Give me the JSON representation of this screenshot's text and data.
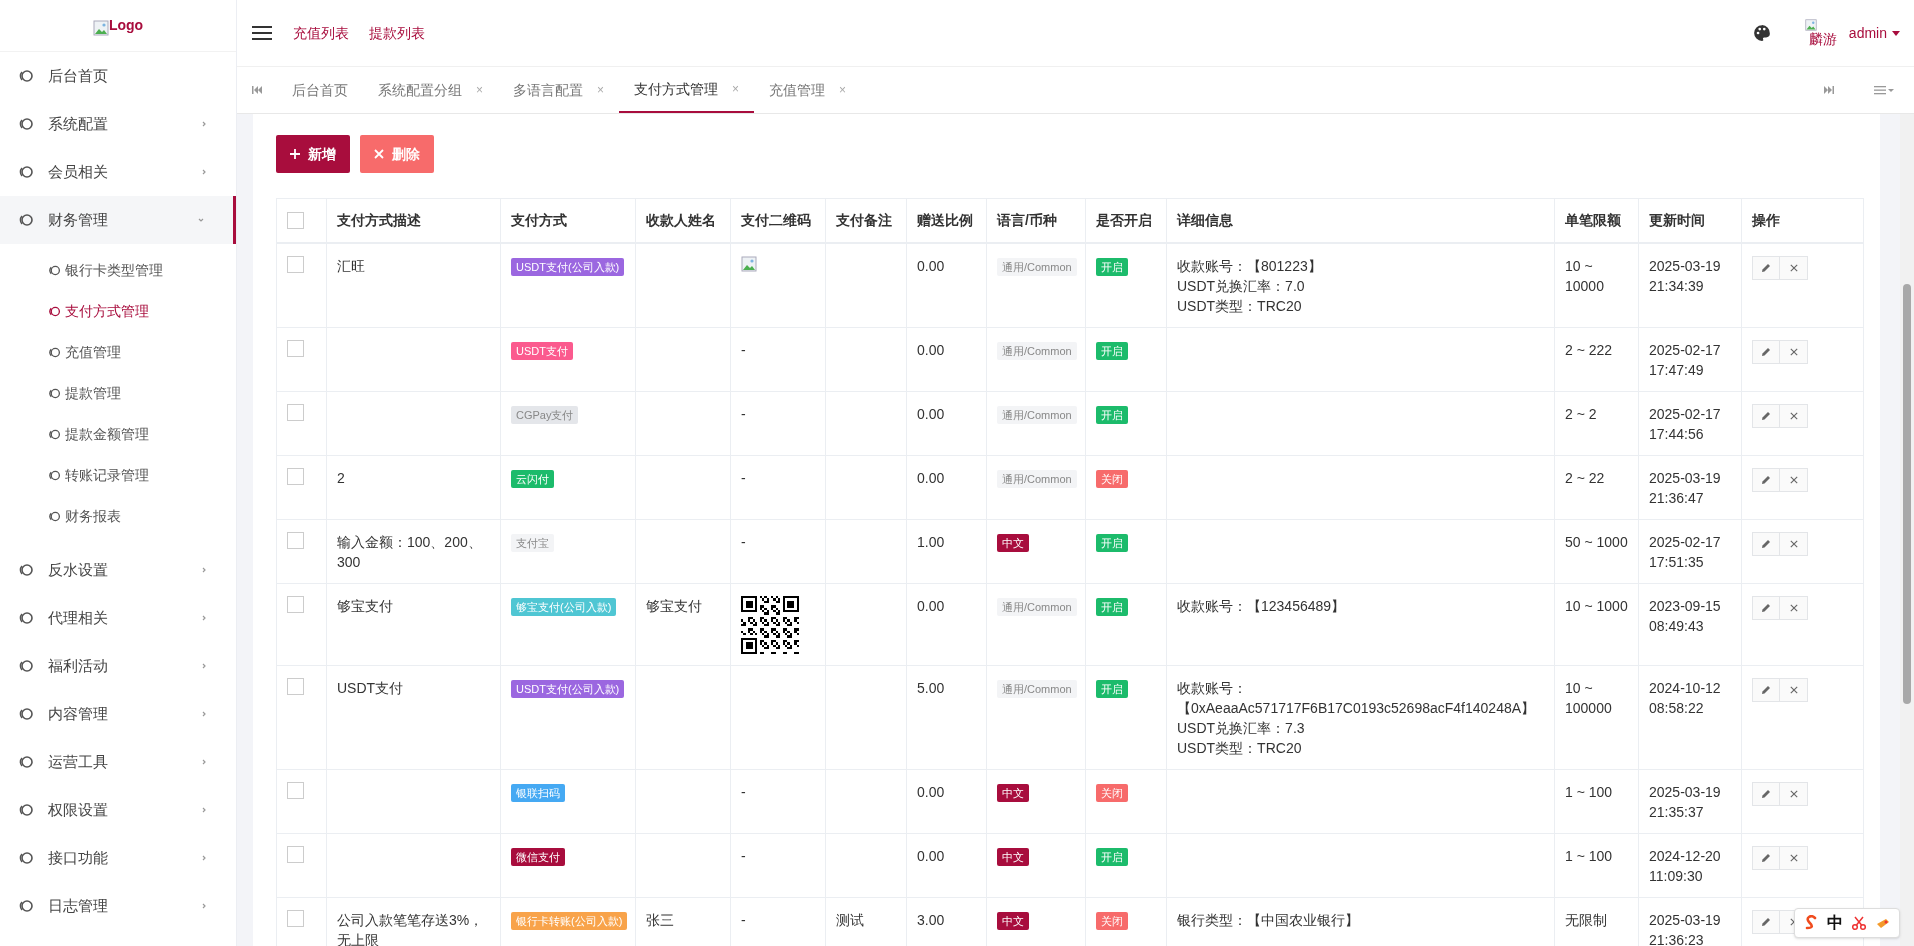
{
  "sidebar": {
    "logo": "Logo",
    "items": [
      {
        "label": "后台首页",
        "has_arrow": false,
        "expanded": false
      },
      {
        "label": "系统配置",
        "has_arrow": true,
        "expanded": false
      },
      {
        "label": "会员相关",
        "has_arrow": true,
        "expanded": false
      },
      {
        "label": "财务管理",
        "has_arrow": true,
        "expanded": true,
        "children": [
          {
            "label": "银行卡类型管理",
            "selected": false
          },
          {
            "label": "支付方式管理",
            "selected": true
          },
          {
            "label": "充值管理",
            "selected": false
          },
          {
            "label": "提款管理",
            "selected": false
          },
          {
            "label": "提款金额管理",
            "selected": false
          },
          {
            "label": "转账记录管理",
            "selected": false
          },
          {
            "label": "财务报表",
            "selected": false
          }
        ]
      },
      {
        "label": "反水设置",
        "has_arrow": true,
        "expanded": false
      },
      {
        "label": "代理相关",
        "has_arrow": true,
        "expanded": false
      },
      {
        "label": "福利活动",
        "has_arrow": true,
        "expanded": false
      },
      {
        "label": "内容管理",
        "has_arrow": true,
        "expanded": false
      },
      {
        "label": "运营工具",
        "has_arrow": true,
        "expanded": false
      },
      {
        "label": "权限设置",
        "has_arrow": true,
        "expanded": false
      },
      {
        "label": "接口功能",
        "has_arrow": true,
        "expanded": false
      },
      {
        "label": "日志管理",
        "has_arrow": true,
        "expanded": false
      }
    ]
  },
  "header": {
    "links": [
      "充值列表",
      "提款列表"
    ],
    "avatar_alt": "麟游",
    "user": "admin"
  },
  "tabs": [
    {
      "label": "后台首页",
      "selected": false,
      "closable": false
    },
    {
      "label": "系统配置分组",
      "selected": false,
      "closable": true,
      "close": "×"
    },
    {
      "label": "多语言配置",
      "selected": false,
      "closable": true,
      "close": "×"
    },
    {
      "label": "支付方式管理",
      "selected": true,
      "closable": true,
      "close": "×"
    },
    {
      "label": "充值管理",
      "selected": false,
      "closable": true,
      "close": "×"
    }
  ],
  "toolbar": {
    "add": "新增",
    "delete": "删除"
  },
  "table": {
    "select_all_checked": false,
    "columns": [
      "支付方式描述",
      "支付方式",
      "收款人姓名",
      "支付二维码",
      "支付备注",
      "赠送比例",
      "语言/币种",
      "是否开启",
      "详细信息",
      "单笔限额",
      "更新时间",
      "操作"
    ],
    "rows": [
      {
        "checked": false,
        "description": "汇旺",
        "method": {
          "text": "USDT支付(公司入款)",
          "color": "#9b67e0"
        },
        "payee": "",
        "qr": {
          "kind": "broken_image"
        },
        "remark": "",
        "ratio": "0.00",
        "lang": {
          "text": "通用/Common",
          "color": "#f3f4f6"
        },
        "enabled": true,
        "status": "开启",
        "details": [
          "收款账号：【801223】",
          "USDT兑换汇率：7.0",
          "USDT类型：TRC20"
        ],
        "limit": "10 ~ 10000",
        "updated": "2025-03-19 21:34:39"
      },
      {
        "checked": false,
        "description": "",
        "method": {
          "text": "USDT支付",
          "color": "#fb5a8e"
        },
        "payee": "",
        "qr": {
          "kind": "text",
          "text": "-"
        },
        "remark": "",
        "ratio": "0.00",
        "lang": {
          "text": "通用/Common",
          "color": "#f3f4f6"
        },
        "enabled": true,
        "status": "开启",
        "details": [],
        "limit": "2 ~ 222",
        "updated": "2025-02-17 17:47:49"
      },
      {
        "checked": false,
        "description": "",
        "method": {
          "text": "CGPay支付",
          "color": "#e4e6ea"
        },
        "payee": "",
        "qr": {
          "kind": "text",
          "text": "-"
        },
        "remark": "",
        "ratio": "0.00",
        "lang": {
          "text": "通用/Common",
          "color": "#f3f4f6"
        },
        "enabled": true,
        "status": "开启",
        "details": [],
        "limit": "2 ~ 2",
        "updated": "2025-02-17 17:44:56"
      },
      {
        "checked": false,
        "description": "2",
        "method": {
          "text": "云闪付",
          "color": "#1cbb6b"
        },
        "payee": "",
        "qr": {
          "kind": "text",
          "text": "-"
        },
        "remark": "",
        "ratio": "0.00",
        "lang": {
          "text": "通用/Common",
          "color": "#f3f4f6"
        },
        "enabled": false,
        "status": "关闭",
        "details": [],
        "limit": "2 ~ 22",
        "updated": "2025-03-19 21:36:47"
      },
      {
        "checked": false,
        "description": "输入金额：100、200、300",
        "method": {
          "text": "支付宝",
          "color": "#f3f4f6"
        },
        "payee": "",
        "qr": {
          "kind": "text",
          "text": "-"
        },
        "remark": "",
        "ratio": "1.00",
        "lang": {
          "text": "中文",
          "color": "#a80d3d"
        },
        "enabled": true,
        "status": "开启",
        "details": [],
        "limit": "50 ~ 1000",
        "updated": "2025-02-17 17:51:35"
      },
      {
        "checked": false,
        "description": "够宝支付",
        "method": {
          "text": "够宝支付(公司入款)",
          "color": "#4fc6d3"
        },
        "payee": "够宝支付",
        "qr": {
          "kind": "qr_code"
        },
        "remark": "",
        "ratio": "0.00",
        "lang": {
          "text": "通用/Common",
          "color": "#f3f4f6"
        },
        "enabled": true,
        "status": "开启",
        "details": [
          "收款账号：【123456489】"
        ],
        "limit": "10 ~ 1000",
        "updated": "2023-09-15 08:49:43"
      },
      {
        "checked": false,
        "description": "USDT支付",
        "method": {
          "text": "USDT支付(公司入款)",
          "color": "#9b67e0"
        },
        "payee": "",
        "qr": {
          "kind": "empty"
        },
        "remark": "",
        "ratio": "5.00",
        "lang": {
          "text": "通用/Common",
          "color": "#f3f4f6"
        },
        "enabled": true,
        "status": "开启",
        "details": [
          "收款账号：【0xAeaaAc571717F6B17C0193c52698acF4f140248A】",
          "USDT兑换汇率：7.3",
          "USDT类型：TRC20"
        ],
        "limit": "10 ~ 100000",
        "updated": "2024-10-12 08:58:22"
      },
      {
        "checked": false,
        "description": "",
        "method": {
          "text": "银联扫码",
          "color": "#45a9f3"
        },
        "payee": "",
        "qr": {
          "kind": "text",
          "text": "-"
        },
        "remark": "",
        "ratio": "0.00",
        "lang": {
          "text": "中文",
          "color": "#a80d3d"
        },
        "enabled": false,
        "status": "关闭",
        "details": [],
        "limit": "1 ~ 100",
        "updated": "2025-03-19 21:35:37"
      },
      {
        "checked": false,
        "description": "",
        "method": {
          "text": "微信支付",
          "color": "#a80d3d"
        },
        "payee": "",
        "qr": {
          "kind": "text",
          "text": "-"
        },
        "remark": "",
        "ratio": "0.00",
        "lang": {
          "text": "中文",
          "color": "#a80d3d"
        },
        "enabled": true,
        "status": "开启",
        "details": [],
        "limit": "1 ~ 100",
        "updated": "2024-12-20 11:09:30"
      },
      {
        "checked": false,
        "description": "公司入款笔笔存送3%，无上限",
        "method": {
          "text": "银行卡转账(公司入款)",
          "color": "#f8a34a"
        },
        "payee": "张三",
        "qr": {
          "kind": "text",
          "text": "-"
        },
        "remark": "测试",
        "ratio": "3.00",
        "lang": {
          "text": "中文",
          "color": "#a80d3d"
        },
        "enabled": false,
        "status": "关闭",
        "details": [
          "银行类型：【中国农业银行】"
        ],
        "limit": "无限制",
        "updated": "2025-03-19 21:36:23"
      }
    ]
  },
  "ime_toolbar": {
    "mode": "中"
  }
}
